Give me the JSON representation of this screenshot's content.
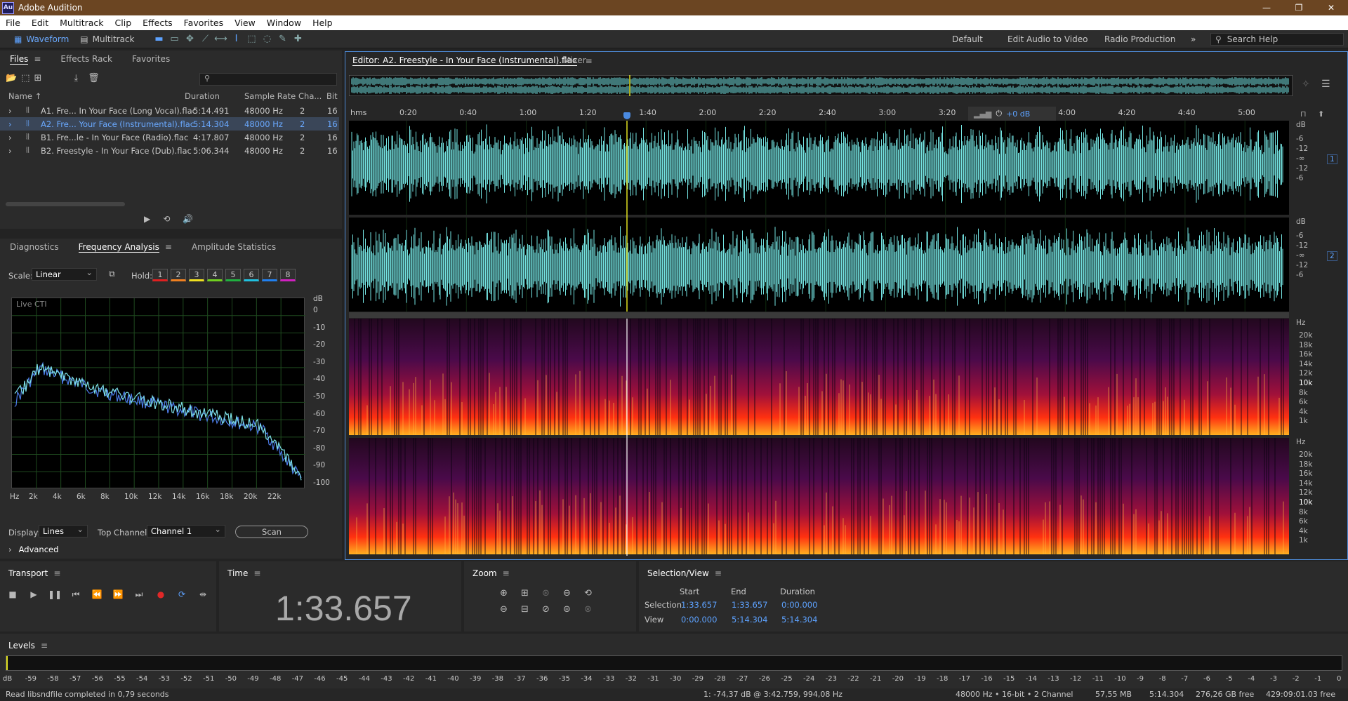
{
  "window": {
    "title": "Adobe Audition",
    "badge": "Au"
  },
  "menu": [
    "File",
    "Edit",
    "Multitrack",
    "Clip",
    "Effects",
    "Favorites",
    "View",
    "Window",
    "Help"
  ],
  "toolbar": {
    "waveform_label": "Waveform",
    "multitrack_label": "Multitrack"
  },
  "workspaces": [
    "Default",
    "Edit Audio to Video",
    "Radio Production"
  ],
  "search_help": "Search Help",
  "files_panel": {
    "tabs": [
      "Files",
      "Effects Rack",
      "Favorites"
    ],
    "columns": [
      "Name",
      "Duration",
      "Sample Rate",
      "Cha...",
      "Bit"
    ],
    "rows": [
      {
        "name": "A1. Fre... In Your Face (Long Vocal).flac",
        "duration": "5:14.491",
        "rate": "48000 Hz",
        "ch": "2",
        "bit": "16",
        "selected": false
      },
      {
        "name": "A2. Fre... Your Face (Instrumental).flac",
        "duration": "5:14.304",
        "rate": "48000 Hz",
        "ch": "2",
        "bit": "16",
        "selected": true
      },
      {
        "name": "B1. Fre...le - In Your Face (Radio).flac",
        "duration": "4:17.807",
        "rate": "48000 Hz",
        "ch": "2",
        "bit": "16",
        "selected": false
      },
      {
        "name": "B2. Freestyle - In Your Face (Dub).flac",
        "duration": "5:06.344",
        "rate": "48000 Hz",
        "ch": "2",
        "bit": "16",
        "selected": false
      }
    ]
  },
  "analysis_panel": {
    "tabs": [
      "Diagnostics",
      "Frequency Analysis",
      "Amplitude Statistics"
    ],
    "scale_label": "Scale:",
    "scale_value": "Linear",
    "hold_label": "Hold:",
    "hold_buttons": [
      "1",
      "2",
      "3",
      "4",
      "5",
      "6",
      "7",
      "8"
    ],
    "hold_colors": [
      "#e02020",
      "#f08020",
      "#f0e020",
      "#70d020",
      "#20b040",
      "#20c0e0",
      "#2080f0",
      "#d020c0"
    ],
    "graph_title": "Live CTI",
    "db_unit": "dB",
    "db_ticks": [
      "0",
      "-10",
      "-20",
      "-30",
      "-40",
      "-50",
      "-60",
      "-70",
      "-80",
      "-90",
      "-100"
    ],
    "hz_ticks": [
      "Hz",
      "2k",
      "4k",
      "6k",
      "8k",
      "10k",
      "12k",
      "14k",
      "16k",
      "18k",
      "20k",
      "22k"
    ],
    "display_label": "Display:",
    "display_value": "Lines",
    "top_channel_label": "Top Channel:",
    "top_channel_value": "Channel 1",
    "scan_label": "Scan",
    "advanced_label": "Advanced"
  },
  "editor": {
    "tab_title": "Editor: A2. Freestyle - In Your Face (Instrumental).flac",
    "mixer_tab": "Mixer",
    "ruler_unit": "hms",
    "ruler_ticks": [
      "0:20",
      "0:40",
      "1:00",
      "1:20",
      "1:40",
      "2:00",
      "2:20",
      "2:40",
      "3:00",
      "3:20",
      "3:40",
      "4:00",
      "4:20",
      "4:40",
      "5:00"
    ],
    "gain_readout": "+0 dB",
    "db_scale": [
      "dB",
      "-6",
      "-12",
      "-∞",
      "-12",
      "-6"
    ],
    "channel_labels": [
      "1",
      "2"
    ],
    "spectral_scale": [
      "Hz",
      "20k",
      "18k",
      "16k",
      "14k",
      "12k",
      "10k",
      "8k",
      "6k",
      "4k",
      "1k"
    ]
  },
  "transport": {
    "title": "Transport"
  },
  "time_panel": {
    "title": "Time",
    "value": "1:33.657"
  },
  "zoom_panel": {
    "title": "Zoom"
  },
  "selection_view": {
    "title": "Selection/View",
    "headers": [
      "Start",
      "End",
      "Duration"
    ],
    "rows": [
      {
        "label": "Selection",
        "start": "1:33.657",
        "end": "1:33.657",
        "duration": "0:00.000"
      },
      {
        "label": "View",
        "start": "0:00.000",
        "end": "5:14.304",
        "duration": "5:14.304"
      }
    ]
  },
  "levels": {
    "title": "Levels",
    "ticks": [
      "dB",
      "-59",
      "-58",
      "-57",
      "-56",
      "-55",
      "-54",
      "-53",
      "-52",
      "-51",
      "-50",
      "-49",
      "-48",
      "-47",
      "-46",
      "-45",
      "-44",
      "-43",
      "-42",
      "-41",
      "-40",
      "-39",
      "-38",
      "-37",
      "-36",
      "-35",
      "-34",
      "-33",
      "-32",
      "-31",
      "-30",
      "-29",
      "-28",
      "-27",
      "-26",
      "-25",
      "-24",
      "-23",
      "-22",
      "-21",
      "-20",
      "-19",
      "-18",
      "-17",
      "-16",
      "-15",
      "-14",
      "-13",
      "-12",
      "-11",
      "-10",
      "-9",
      "-8",
      "-7",
      "-6",
      "-5",
      "-4",
      "-3",
      "-2",
      "-1",
      "0"
    ]
  },
  "status": {
    "message": "Read libsndfile completed in 0,79 seconds",
    "cursor": "1: -74,37 dB @ 3:42.759, 994,08 Hz",
    "format": "48000 Hz • 16-bit • 2 Channel",
    "size": "57,55 MB",
    "duration": "5:14.304",
    "free": "276,26 GB free",
    "free_time": "429:09:01.03 free"
  }
}
